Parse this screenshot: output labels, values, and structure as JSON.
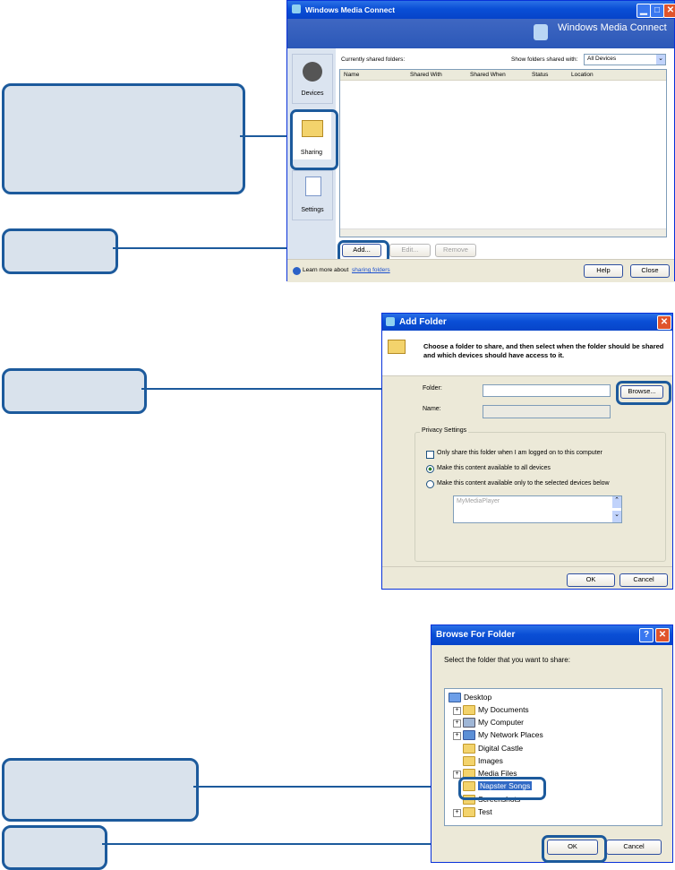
{
  "wmc": {
    "title": "Windows Media Connect",
    "header_brand": "Windows Media Connect",
    "sidebar": [
      {
        "label": "Devices"
      },
      {
        "label": "Sharing"
      },
      {
        "label": "Settings"
      }
    ],
    "shared_label": "Currently shared folders:",
    "show_label": "Show folders shared with:",
    "show_value": "All Devices",
    "columns": [
      "Name",
      "Shared With",
      "Shared When",
      "Status",
      "Location"
    ],
    "add_label": "Add...",
    "edit_label": "Edit...",
    "remove_label": "Remove",
    "learn_text": "Learn more about",
    "learn_link": "sharing folders",
    "help_label": "Help",
    "close_label": "Close"
  },
  "add_folder": {
    "title": "Add Folder",
    "instruction": "Choose a folder to share, and then select when the folder should be shared and which devices should have access to it.",
    "folder_label": "Folder:",
    "folder_value": "",
    "browse_label": "Browse...",
    "name_label": "Name:",
    "privacy_legend": "Privacy Settings",
    "opt1": "Only share this folder when I am logged on to this computer",
    "opt2": "Make this content available to all devices",
    "opt3": "Make this content available only to the selected devices below",
    "device": "MyMediaPlayer",
    "ok_label": "OK",
    "cancel_label": "Cancel"
  },
  "browse": {
    "title": "Browse For Folder",
    "prompt": "Select the folder that you want to share:",
    "tree": [
      "Desktop",
      "My Documents",
      "My Computer",
      "My Network Places",
      "Digital Castle",
      "Images",
      "Media Files",
      "Napster Songs",
      "Screenshots",
      "Test"
    ],
    "selected": "Napster Songs",
    "ok_label": "OK",
    "cancel_label": "Cancel"
  }
}
